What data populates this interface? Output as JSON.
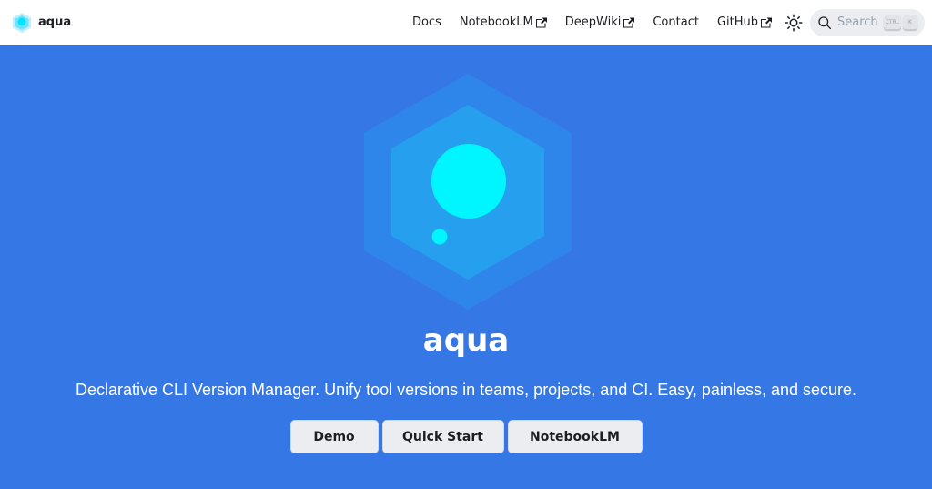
{
  "navbar": {
    "brand_title": "aqua",
    "links": [
      {
        "label": "Docs",
        "external": false
      },
      {
        "label": "NotebookLM",
        "external": true
      },
      {
        "label": "DeepWiki",
        "external": true
      },
      {
        "label": "Contact",
        "external": false
      },
      {
        "label": "GitHub",
        "external": true
      }
    ],
    "theme_toggle_icon": "sun-icon",
    "search": {
      "placeholder": "Search",
      "keys": [
        "CTRL",
        "K"
      ]
    }
  },
  "hero": {
    "title": "aqua",
    "tagline": "Declarative CLI Version Manager. Unify tool versions in teams, projects, and CI. Easy, painless, and secure.",
    "buttons": {
      "demo": "Demo",
      "quick_start": "Quick Start",
      "notebooklm": "NotebookLM"
    }
  },
  "colors": {
    "hero_bg": "#3578e5",
    "hex_outer": "#2f86ea",
    "hex_inner": "#269fee",
    "bubble": "#00f6ff",
    "navbar_bg": "#ffffff",
    "button_bg": "#ebedf0"
  }
}
